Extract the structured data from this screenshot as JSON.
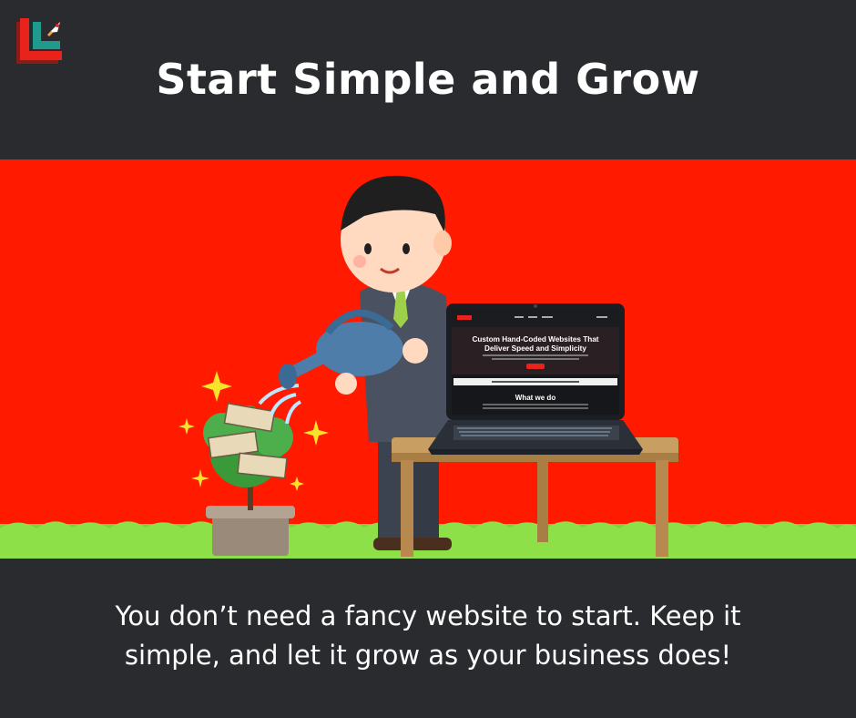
{
  "header": {
    "logo": "brand-logo",
    "title": "Start Simple and Grow"
  },
  "illustration": {
    "subject": "businessman watering a money tree with a laptop on a table",
    "colors": {
      "background": "#ff1a00",
      "grass": "#7fd23a"
    },
    "laptop_screen": {
      "hero_heading_line1": "Custom Hand-Coded Websites That",
      "hero_heading_line2": "Deliver Speed and Simplicity",
      "section_heading": "What we do"
    }
  },
  "footer": {
    "caption_line1": "You don’t need a fancy website to start. Keep it",
    "caption_line2": "simple, and let it grow as your business does!"
  },
  "colors": {
    "background": "#2a2b2e",
    "text": "#ffffff",
    "logo_red": "#e8231b",
    "logo_teal": "#1f9a8e"
  }
}
